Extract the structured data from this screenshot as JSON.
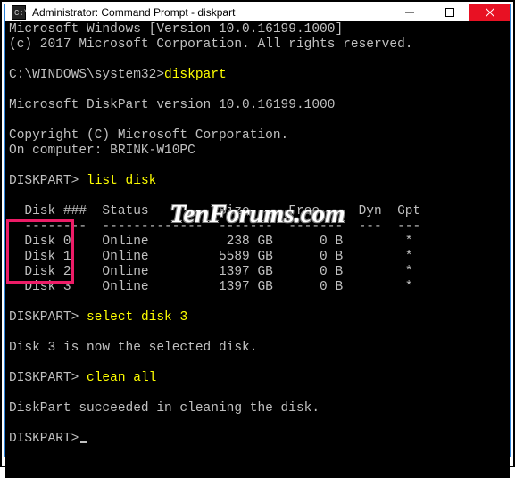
{
  "titlebar": {
    "title": "Administrator: Command Prompt - diskpart"
  },
  "lines": {
    "winver": "Microsoft Windows [Version 10.0.16199.1000]",
    "copyright1": "(c) 2017 Microsoft Corporation. All rights reserved.",
    "prompt_path": "C:\\WINDOWS\\system32>",
    "cmd_diskpart": "diskpart",
    "dp_ver": "Microsoft DiskPart version 10.0.16199.1000",
    "dp_copy": "Copyright (C) Microsoft Corporation.",
    "dp_comp": "On computer: BRINK-W10PC",
    "dp_prompt": "DISKPART>",
    "cmd_list": "list disk",
    "tbl_header": "  Disk ###  Status         Size     Free     Dyn  Gpt",
    "tbl_sep": "  --------  -------------  -------  -------  ---  ---",
    "row0": "  Disk 0    Online          238 GB      0 B        *",
    "row1": "  Disk 1    Online         5589 GB      0 B        *",
    "row2": "  Disk 2    Online         1397 GB      0 B        *",
    "row3": "  Disk 3    Online         1397 GB      0 B        *",
    "cmd_select": "select disk 3",
    "sel_msg": "Disk 3 is now the selected disk.",
    "cmd_clean": "clean all",
    "clean_msg": "DiskPart succeeded in cleaning the disk."
  },
  "watermark": "TenForums.com",
  "chart_data": {
    "type": "table",
    "title": "list disk",
    "columns": [
      "Disk ###",
      "Status",
      "Size",
      "Free",
      "Dyn",
      "Gpt"
    ],
    "rows": [
      {
        "Disk ###": "Disk 0",
        "Status": "Online",
        "Size": "238 GB",
        "Free": "0 B",
        "Dyn": "",
        "Gpt": "*"
      },
      {
        "Disk ###": "Disk 1",
        "Status": "Online",
        "Size": "5589 GB",
        "Free": "0 B",
        "Dyn": "",
        "Gpt": "*"
      },
      {
        "Disk ###": "Disk 2",
        "Status": "Online",
        "Size": "1397 GB",
        "Free": "0 B",
        "Dyn": "",
        "Gpt": "*"
      },
      {
        "Disk ###": "Disk 3",
        "Status": "Online",
        "Size": "1397 GB",
        "Free": "0 B",
        "Dyn": "",
        "Gpt": "*"
      }
    ]
  }
}
